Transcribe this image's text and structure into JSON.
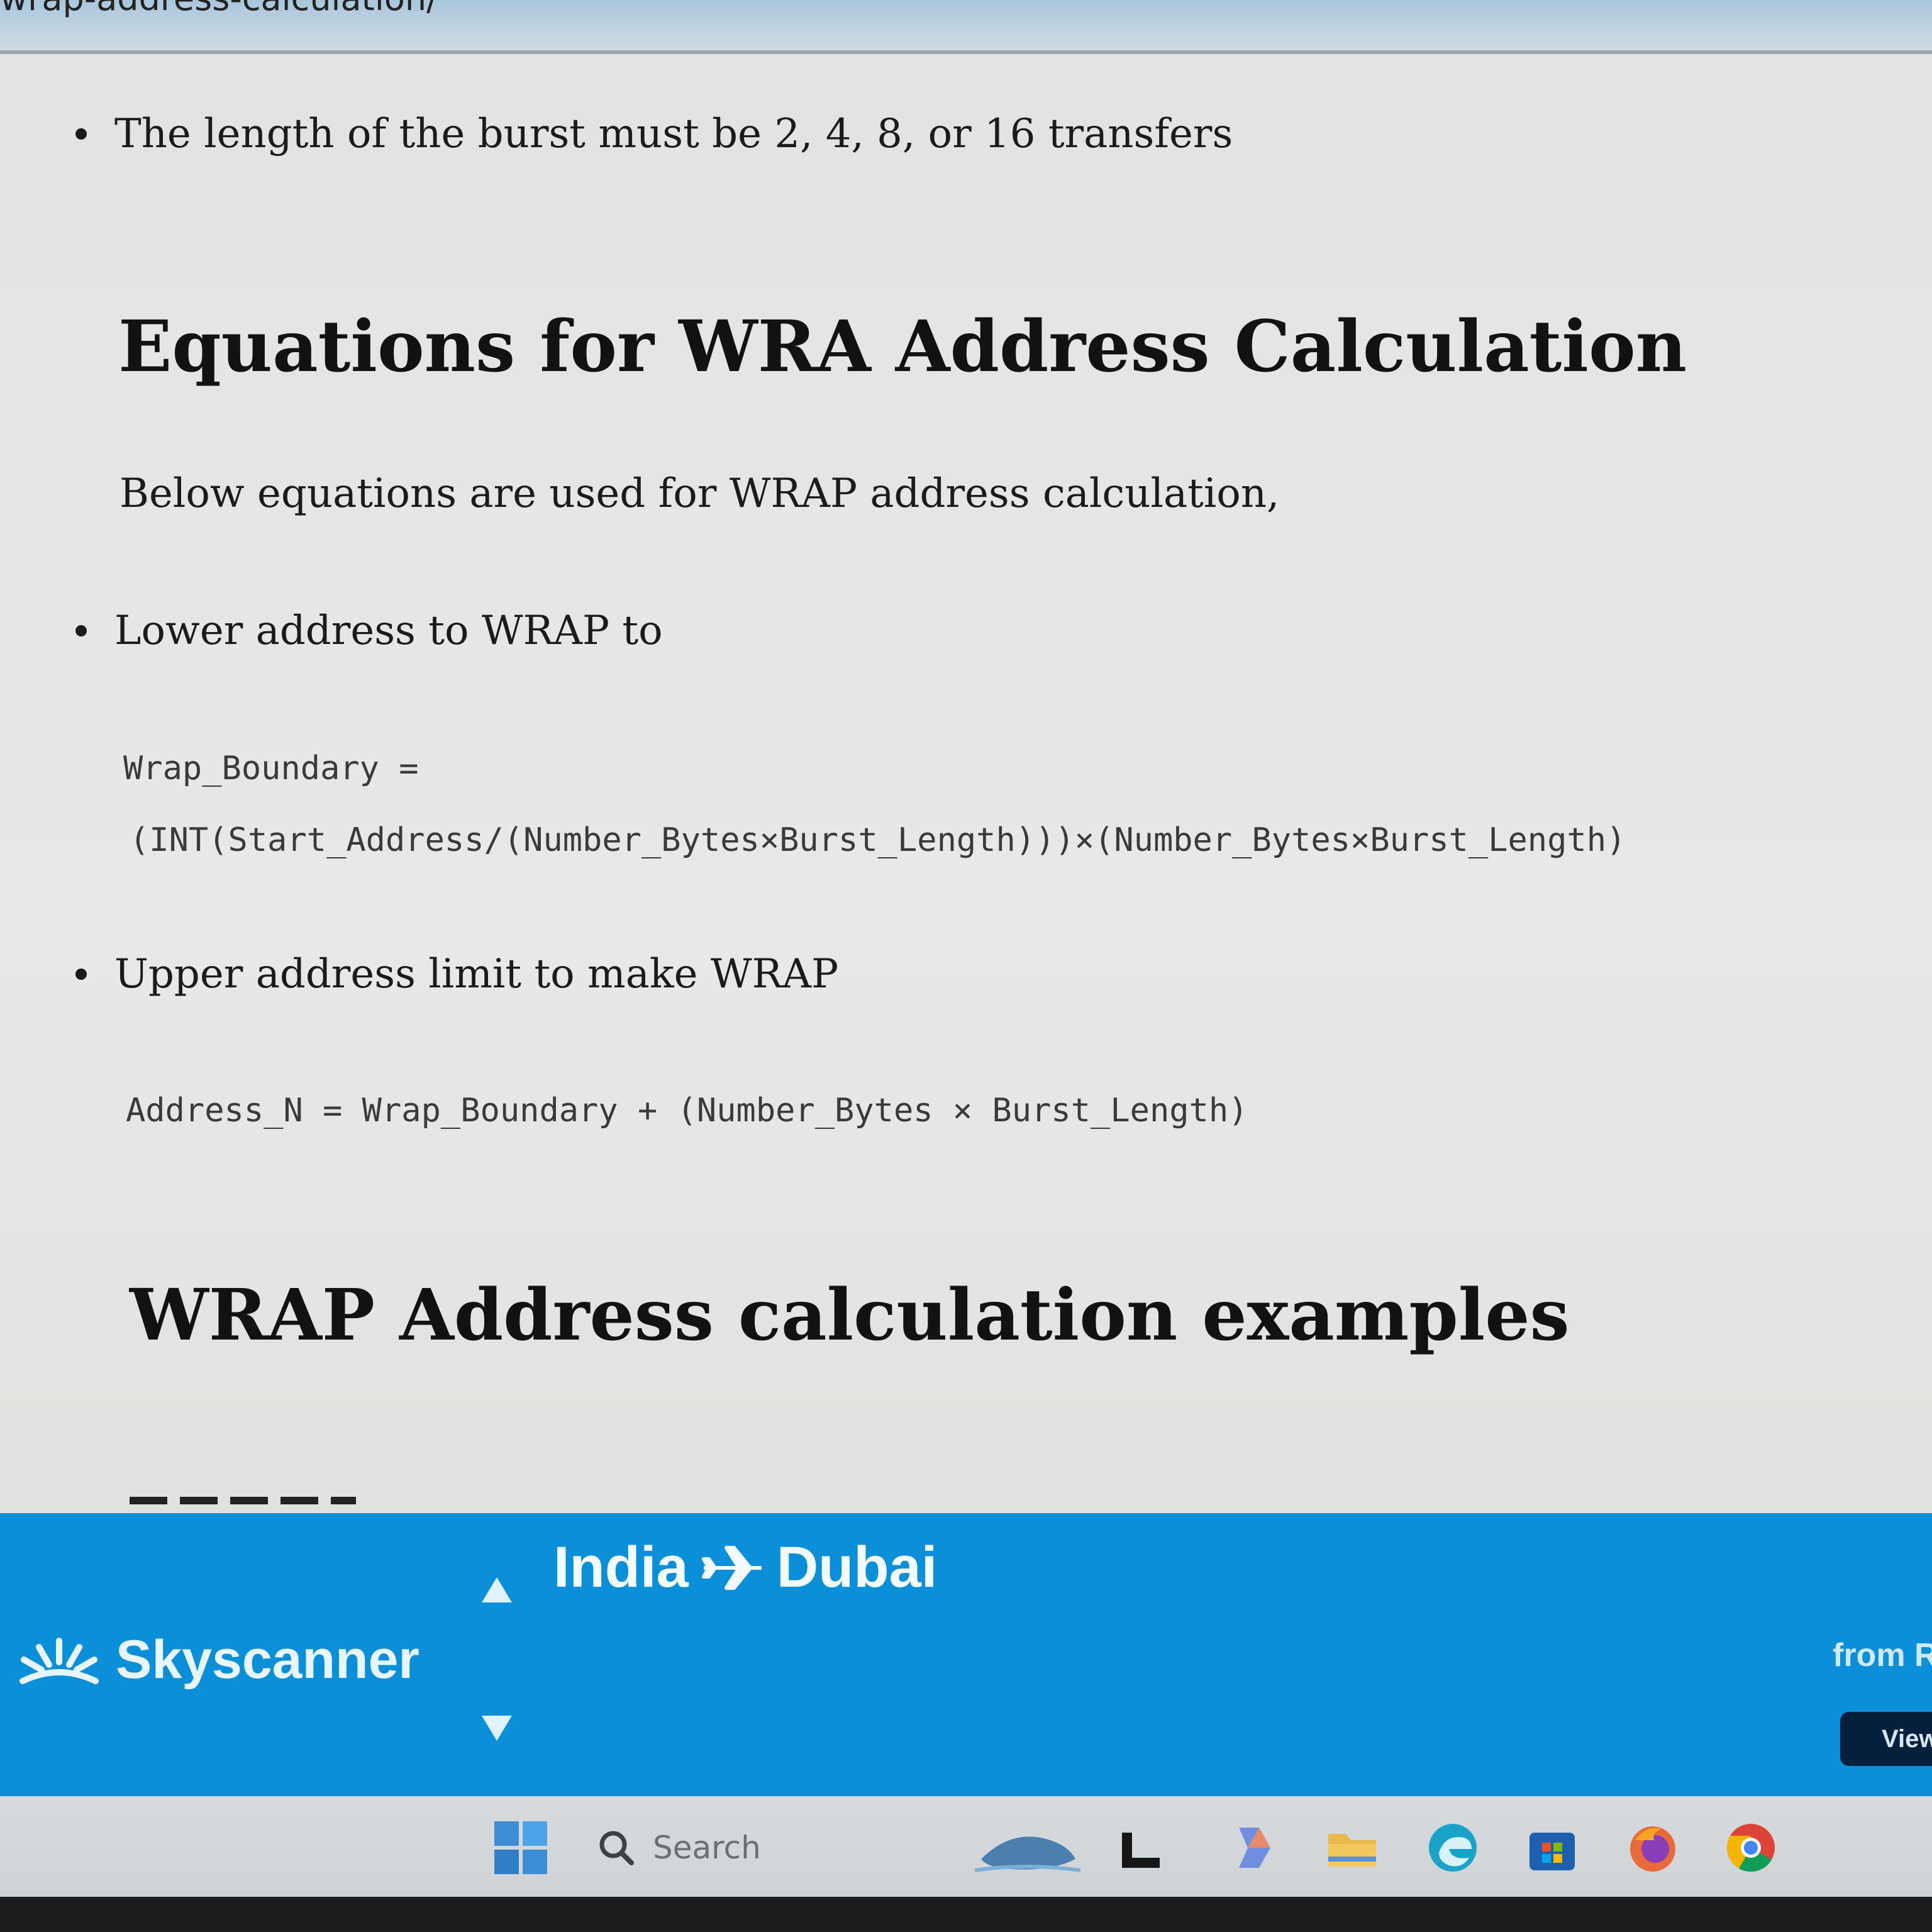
{
  "browser": {
    "partial_url_text": "wrap-address-calculation/"
  },
  "article": {
    "intro_bullet": "The length of the burst must be 2, 4, 8, or 16 transfers",
    "heading_equations": "Equations for WRA Address Calculation",
    "paragraph": "Below equations are used for WRAP address calculation,",
    "bullet_lower": "Lower address to WRAP to",
    "code_lower_line1": "Wrap_Boundary =",
    "code_lower_line2": "(INT(Start_Address/(Number_Bytes×Burst_Length)))×(Number_Bytes×Burst_Length)",
    "bullet_upper": "Upper address limit to make WRAP",
    "code_upper": "Address_N = Wrap_Boundary + (Number_Bytes × Burst_Length)",
    "heading_examples": "WRAP Address calculation examples"
  },
  "ad_banner": {
    "brand": "Skyscanner",
    "route_from": "India",
    "route_to": "Dubai",
    "from_text": "from R",
    "view_label": "View",
    "background_color": "#0a8fd8"
  },
  "taskbar": {
    "search_placeholder": "Search",
    "icons": [
      "windows-start-icon",
      "search-icon",
      "widgets-icon",
      "file-explorer-l-icon",
      "copilot-icon",
      "folder-icon",
      "edge-icon",
      "store-icon",
      "firefox-icon",
      "chrome-icon"
    ]
  }
}
